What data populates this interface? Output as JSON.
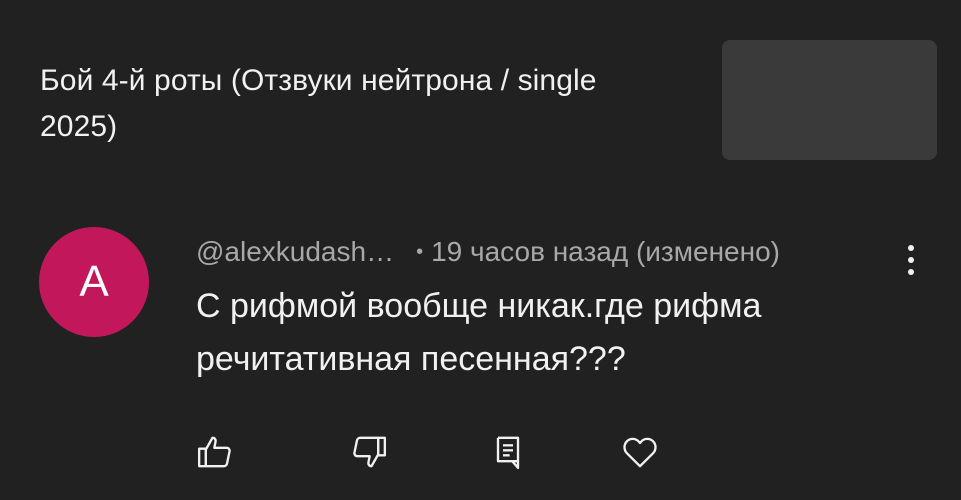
{
  "video": {
    "title": "Бой 4-й роты (Отзвуки нейтрона / single 2025)"
  },
  "comment": {
    "avatar_letter": "A",
    "avatar_color": "#c2185b",
    "handle": "@alexkudash…",
    "separator": "•",
    "time": "19 часов назад (изменено)",
    "text": "С рифмой вообще никак.где рифма речитативная песенная???"
  },
  "actions": {
    "like_icon": "thumb-up-icon",
    "dislike_icon": "thumb-down-icon",
    "reply_icon": "reply-comment-icon",
    "heart_icon": "heart-icon"
  },
  "menu_icon": "more-vert-icon"
}
